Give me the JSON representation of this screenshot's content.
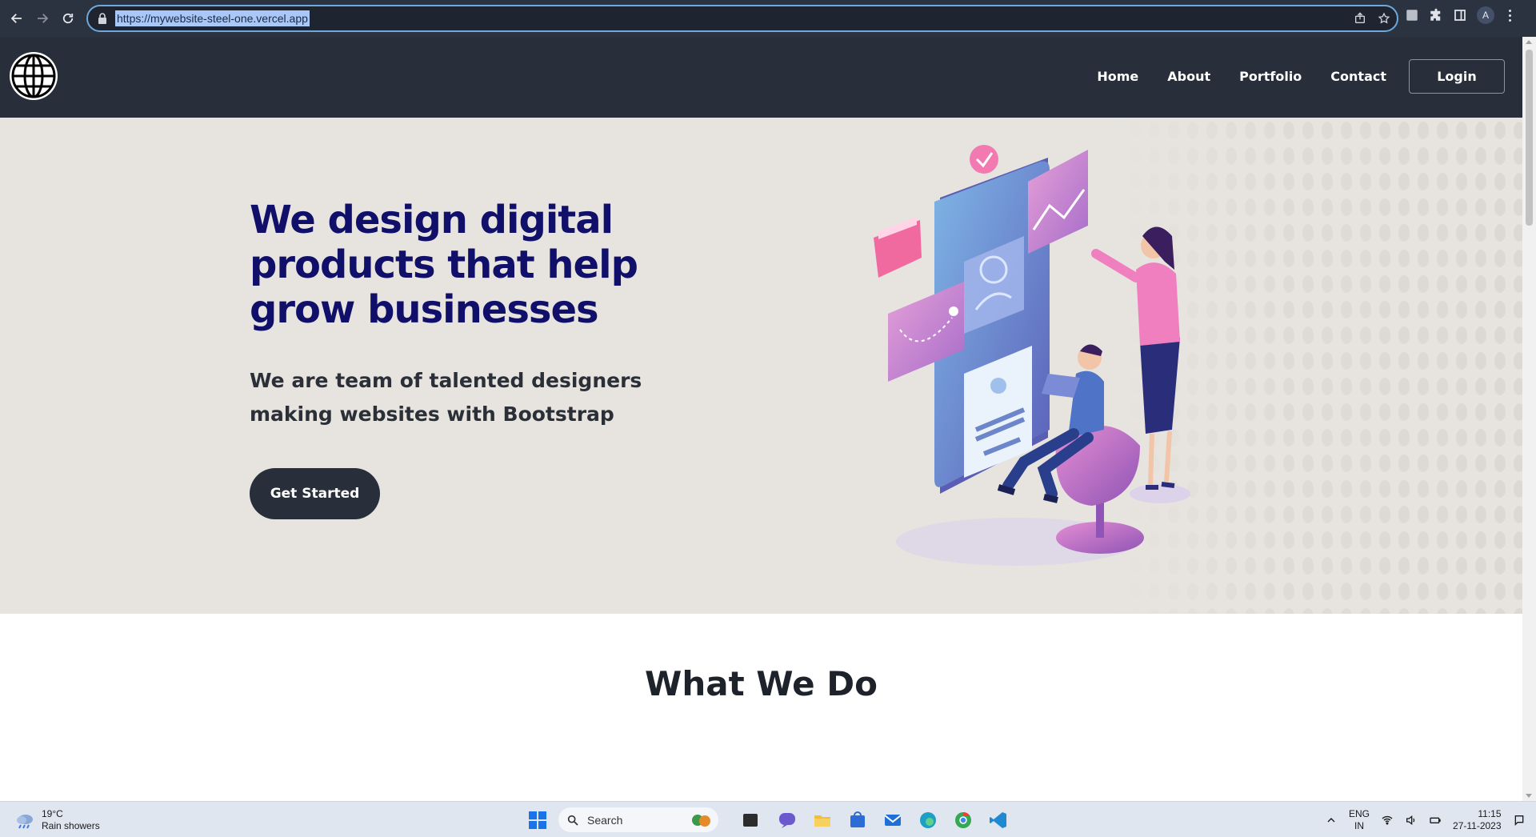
{
  "browser": {
    "url": "https://mywebsite-steel-one.vercel.app",
    "profile_initial": "A"
  },
  "site_nav": {
    "links": [
      "Home",
      "About",
      "Portfolio",
      "Contact"
    ],
    "login_label": "Login"
  },
  "hero": {
    "title": "We design digital products that help grow businesses",
    "subtitle": "We are team of talented designers making websites with Bootstrap",
    "cta_label": "Get Started"
  },
  "section": {
    "title": "What We Do"
  },
  "taskbar": {
    "weather_temp": "19°C",
    "weather_desc": "Rain showers",
    "search_placeholder": "Search",
    "lang_top": "ENG",
    "lang_bottom": "IN",
    "time": "11:15",
    "date": "27-11-2023"
  },
  "colors": {
    "navbar": "#282f3b",
    "hero_bg": "#e7e4e0",
    "hero_title": "#10106a",
    "cta": "#282f3b"
  }
}
